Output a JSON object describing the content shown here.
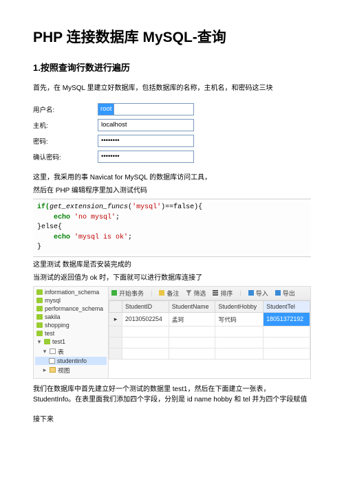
{
  "title": "PHP 连接数据库 MySQL-查询",
  "section1_heading": "1.按照查询行数进行遍历",
  "intro": "首先，在 MySQL 里建立好数据库，包括数据库的名称，主机名，和密码这三块",
  "form": {
    "user_label": "用户名:",
    "user_value": "root",
    "host_label": "主机:",
    "host_value": "localhost",
    "pwd_label": "密码:",
    "pwd_value": "••••••••",
    "pwd2_label": "确认密码:",
    "pwd2_value": "••••••••"
  },
  "text_afterform_1": "这里，我采用的事 Navicat for MySQL  的数据库访问工具，",
  "text_afterform_2": "然后在 PHP 编辑程序里加入测试代码",
  "code": {
    "l1a": "if(",
    "l1b": "get_extension_funcs",
    "l1c": "(",
    "l1d": "'mysql'",
    "l1e": ")==false){",
    "l2a": "    echo ",
    "l2b": "'no mysql'",
    "l2c": ";",
    "l3": "}else{",
    "l4a": "    echo ",
    "l4b": "'mysql is ok'",
    "l4c": ";",
    "l5": "}"
  },
  "text_aftercode_1": "这里测试 数据库是否安装完成的",
  "text_aftercode_2": "当测试的返回值为 ok 时，下面就可以进行数据库连接了",
  "toolbar": {
    "begin": "开始事务",
    "note": "备注",
    "filter": "筛选",
    "sort": "排序",
    "import": "导入",
    "export": "导出"
  },
  "tree": {
    "n0": "information_schema",
    "n1": "mysql",
    "n2": "performance_schema",
    "n3": "sakila",
    "n4": "shopping",
    "n5": "test",
    "n6": "test1",
    "n7": "表",
    "n8": "studentinfo",
    "n9": "视图"
  },
  "grid": {
    "h1": "StudentID",
    "h2": "StudentName",
    "h3": "StudentHobby",
    "h4": "StudentTel",
    "r1c1": "20130502254",
    "r1c2": "孟珂",
    "r1c3": "写代码",
    "r1c4": "18051372192"
  },
  "para_after_navicat": "我们在数据库中首先建立好一个测试的数据里 test1，然后在下面建立一张表，StudentInfo。在表里面我们添加四个字段，分别是 id name hobby  和 tel 并为四个字段赋值",
  "last": "接下来"
}
